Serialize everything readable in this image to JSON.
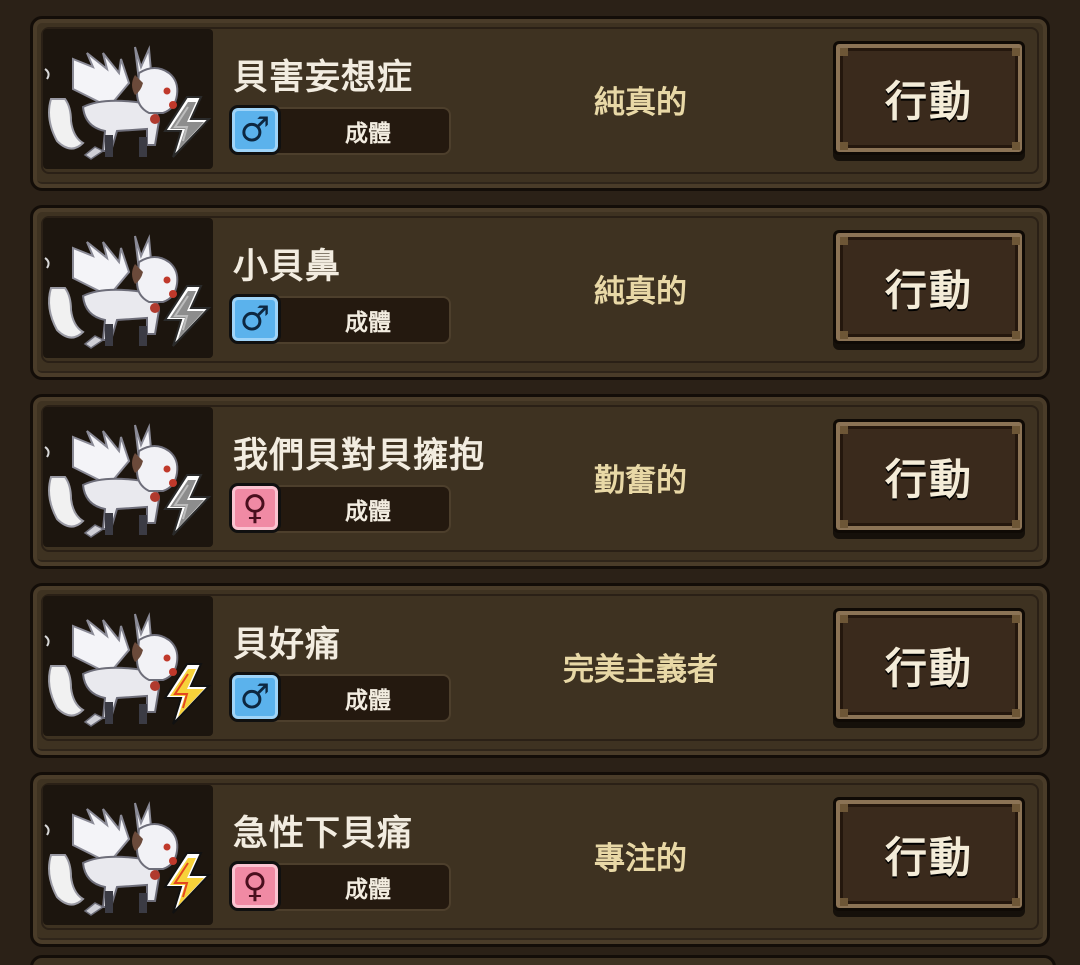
{
  "action_label": "行動",
  "units": [
    {
      "name": "貝害妄想症",
      "gender": "male",
      "gender_symbol": "♂",
      "stage": "成體",
      "trait": "純真的",
      "element": "gray"
    },
    {
      "name": "小貝鼻",
      "gender": "male",
      "gender_symbol": "♂",
      "stage": "成體",
      "trait": "純真的",
      "element": "gray"
    },
    {
      "name": "我們貝對貝擁抱",
      "gender": "female",
      "gender_symbol": "♀",
      "stage": "成體",
      "trait": "勤奮的",
      "element": "gray"
    },
    {
      "name": "貝好痛",
      "gender": "male",
      "gender_symbol": "♂",
      "stage": "成體",
      "trait": "完美主義者",
      "element": "yellow"
    },
    {
      "name": "急性下貝痛",
      "gender": "female",
      "gender_symbol": "♀",
      "stage": "成體",
      "trait": "專注的",
      "element": "yellow"
    }
  ],
  "colors": {
    "bolt_gray": "#8d8d8d",
    "bolt_yellow": "#f7d23a",
    "male": "#5bb2ec",
    "female": "#f08aa4",
    "trait_text": "#e8d8a6"
  },
  "icons": {
    "portrait": "white-winged-wolf-sprite",
    "element": "lightning-bolt-icon"
  }
}
